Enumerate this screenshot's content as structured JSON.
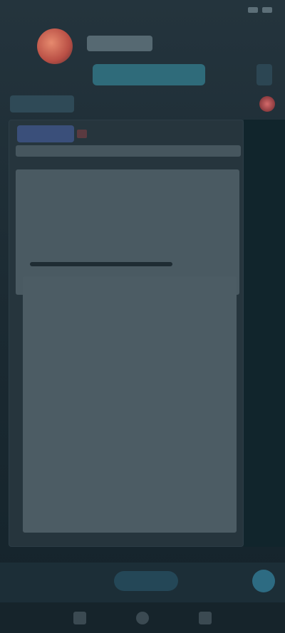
{
  "status_bar": {
    "time": "",
    "battery": ""
  },
  "header": {
    "title": "",
    "subtitle": ""
  },
  "colors": {
    "background": "#1b2a32",
    "accent": "#2f6b7a",
    "alert": "#d46a6a"
  },
  "nav": {
    "items": [
      "back-icon",
      "home-icon",
      "recent-apps-icon"
    ]
  }
}
